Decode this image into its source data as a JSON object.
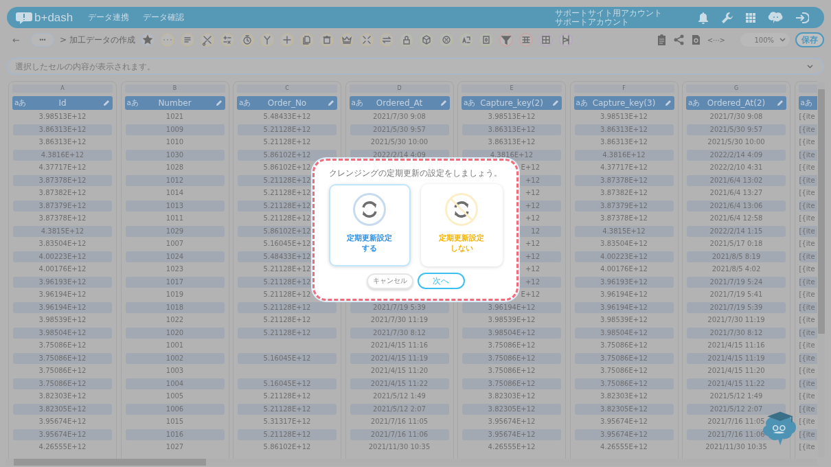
{
  "header": {
    "logo": "b+dash",
    "nav": [
      {
        "label": "データ連携"
      },
      {
        "label": "データ確認"
      }
    ],
    "account_lines": [
      "サポートサイト用アカウント",
      "サポートアカウント"
    ]
  },
  "toolbar": {
    "back": "←",
    "more": "•••",
    "breadcrumb": "> 加工データの作成",
    "code": "<···>",
    "zoom": "100%",
    "save": "保存"
  },
  "formula_bar": {
    "placeholder": "選択したセルの内容が表示されます。"
  },
  "columns": [
    {
      "letter": "A",
      "type_label": "aあ",
      "name": "Id",
      "cut": false,
      "cells": [
        "3.98513E+12",
        "3.86313E+12",
        "3.86313E+12",
        "4.3816E+12",
        "4.37717E+12",
        "3.87378E+12",
        "3.87382E+12",
        "3.87379E+12",
        "3.87378E+12",
        "4.3815E+12",
        "3.83504E+12",
        "4.00223E+12",
        "4.00176E+12",
        "3.96193E+12",
        "3.96194E+12",
        "3.96194E+12",
        "3.98539E+12",
        "3.98504E+12",
        "3.75086E+12",
        "3.75086E+12",
        "3.75086E+12",
        "3.75086E+12",
        "3.82303E+12",
        "3.82305E+12",
        "3.95674E+12",
        "3.95674E+12",
        "4.26555E+12"
      ]
    },
    {
      "letter": "B",
      "type_label": "aあ",
      "name": "Number",
      "cut": false,
      "cells": [
        "1021",
        "1009",
        "1010",
        "1030",
        "1028",
        "1012",
        "1014",
        "1013",
        "1011",
        "1029",
        "1007",
        "1024",
        "1023",
        "1017",
        "1019",
        "1018",
        "1022",
        "1020",
        "1001",
        "1002",
        "1003",
        "1004",
        "1005",
        "1006",
        "1015",
        "1016",
        "1027"
      ]
    },
    {
      "letter": "C",
      "type_label": "aあ",
      "name": "Order_No",
      "cut": false,
      "cells": [
        "5.48433E+12",
        "5.21128E+12",
        "5.21128E+12",
        "5.86102E+12",
        "5.86102E+12",
        "5.21128E+12",
        "5.21128E+12",
        "5.21128E+12",
        "5.21128E+12",
        "5.86102E+12",
        "5.16045E+12",
        "5.48433E+12",
        "5.21128E+12",
        "5.21128E+12",
        "5.21128E+12",
        "5.21128E+12",
        "5.21128E+12",
        "5.21128E+12",
        null,
        "5.16045E+12",
        null,
        "5.16045E+12",
        "5.21128E+12",
        "5.21128E+12",
        "5.31317E+12",
        "5.21128E+12",
        "5.86102E+12"
      ]
    },
    {
      "letter": "D",
      "type_label": "aあ",
      "name": "Ordered_At",
      "cut": false,
      "cells": [
        "2021/7/30 9:08",
        "2021/5/30 9:57",
        "2021/5/30 10:00",
        "2022/2/14 4:09",
        null,
        null,
        null,
        null,
        null,
        null,
        null,
        null,
        null,
        null,
        null,
        "2021/7/19 5:39",
        "2021/7/30 11:19",
        "2021/7/30 8:12",
        "2021/4/15 11:16",
        "2021/4/15 11:19",
        "2021/4/15 11:20",
        "2021/4/15 11:22",
        "2021/5/12 1:49",
        "2021/5/12 2:07",
        "2021/7/16 11:05",
        "2021/7/16 11:06",
        "2021/11/30 10:35"
      ]
    },
    {
      "letter": "E",
      "type_label": "aあ",
      "name": "Capture_key(2)",
      "cut": false,
      "cells": [
        "3.98513E+12",
        "3.86313E+12",
        "3.86313E+12",
        "4.3816E+12",
        {
          "text": "E+12",
          "clipped": true
        },
        {
          "text": "+12",
          "clipped": true
        },
        {
          "text": "+12",
          "clipped": true
        },
        {
          "text": "+12",
          "clipped": true
        },
        {
          "text": "+12",
          "clipped": true
        },
        {
          "text": "12",
          "clipped": true
        },
        {
          "text": "+12",
          "clipped": true
        },
        {
          "text": "+12",
          "clipped": true
        },
        {
          "text": "+12",
          "clipped": true
        },
        {
          "text": "+12",
          "clipped": true
        },
        {
          "text": "E+12",
          "clipped": true
        },
        "3.96194E+12",
        "3.98539E+12",
        "3.98504E+12",
        "3.75086E+12",
        "3.75086E+12",
        "3.75086E+12",
        "3.75086E+12",
        "3.82303E+12",
        "3.82305E+12",
        "3.95674E+12",
        "3.95674E+12",
        "4.26555E+12"
      ]
    },
    {
      "letter": "F",
      "type_label": "aあ",
      "name": "Capture_key(3)",
      "cut": false,
      "cells": [
        "3.98513E+12",
        "3.86313E+12",
        "3.86313E+12",
        "4.3816E+12",
        "4.37717E+12",
        "3.87378E+12",
        "3.87382E+12",
        "3.87379E+12",
        "3.87378E+12",
        "4.3815E+12",
        "3.83504E+12",
        "4.00223E+12",
        "4.00176E+12",
        "3.96193E+12",
        "3.96194E+12",
        "3.96194E+12",
        "3.98539E+12",
        "3.98504E+12",
        "3.75086E+12",
        "3.75086E+12",
        "3.75086E+12",
        "3.75086E+12",
        "3.82303E+12",
        "3.82305E+12",
        "3.95674E+12",
        "3.95674E+12",
        "4.26555E+12"
      ]
    },
    {
      "letter": "G",
      "type_label": "aあ",
      "name": "Ordered_At(2)",
      "cut": false,
      "cells": [
        "2021/7/30 9:08",
        "2021/5/30 9:57",
        "2021/5/30 10:00",
        "2022/2/14 4:09",
        "2022/2/10 4:31",
        "2021/6/4 13:02",
        "2021/6/4 13:27",
        "2021/6/4 13:06",
        "2021/6/4 12:58",
        "2022/2/14 1:15",
        "2021/5/17 0:18",
        "2021/8/5 8:19",
        "2021/8/5 4:02",
        "2021/7/19 5:24",
        "2021/7/19 5:41",
        "2021/7/19 5:39",
        "2021/7/30 11:19",
        "2021/7/30 8:12",
        "2021/4/15 11:16",
        "2021/4/15 11:19",
        "2021/4/15 11:20",
        "2021/4/15 11:22",
        "2021/5/12 1:49",
        "2021/5/12 2:07",
        "2021/7/16 11:05",
        "2021/7/16 11:06",
        "2021/11/30 10:35"
      ]
    },
    {
      "type_label": "aあ",
      "cut": true,
      "cells": [
        "[{ite",
        "[{ite",
        "[{ite",
        "[{ite",
        "[{ite",
        "[{ite",
        "[{ite",
        "[{ite",
        "[{ite",
        "[{ite",
        "[{ite",
        "[{ite",
        "[{ite",
        "[{ite",
        "[{ite",
        "[{ite",
        "[{ite",
        "[{ite",
        "[{ite",
        "[{ite",
        "[{ite",
        "[{ite",
        "[{ite",
        "[{ite",
        "[{ite",
        "[{ite",
        "[{ite"
      ]
    }
  ],
  "dialog": {
    "title": "クレンジングの定期更新の設定をしましょう。",
    "options": [
      {
        "kind": "on",
        "lines": [
          "定期更新設定",
          "する"
        ],
        "selected": true
      },
      {
        "kind": "off",
        "lines": [
          "定期更新設定",
          "しない"
        ],
        "selected": false
      }
    ],
    "cancel": "キャンセル",
    "next": "次へ"
  }
}
